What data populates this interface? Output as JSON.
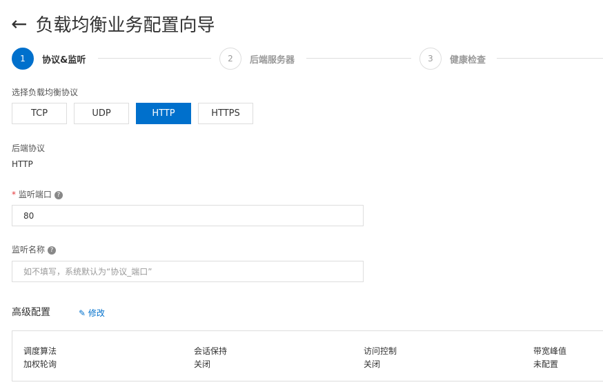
{
  "header": {
    "back_icon": "arrow-left-icon",
    "title": "负载均衡业务配置向导"
  },
  "steps": [
    {
      "num": "1",
      "label": "协议&监听"
    },
    {
      "num": "2",
      "label": "后端服务器"
    },
    {
      "num": "3",
      "label": "健康检查"
    }
  ],
  "protocol": {
    "label": "选择负载均衡协议",
    "options": [
      "TCP",
      "UDP",
      "HTTP",
      "HTTPS"
    ],
    "selected": "HTTP"
  },
  "backend": {
    "label": "后端协议",
    "value": "HTTP"
  },
  "port": {
    "required": "*",
    "label": "监听端口",
    "help": "?",
    "value": "80"
  },
  "name": {
    "label": "监听名称",
    "help": "?",
    "placeholder": "如不填写，系统默认为“协议_端口”"
  },
  "advanced": {
    "title": "高级配置",
    "edit_label": "修改",
    "items": [
      {
        "label": "调度算法",
        "value": "加权轮询"
      },
      {
        "label": "会话保持",
        "value": "关闭"
      },
      {
        "label": "访问控制",
        "value": "关闭"
      },
      {
        "label": "带宽峰值",
        "value": "未配置"
      }
    ]
  },
  "colors": {
    "accent": "#0070cc"
  }
}
